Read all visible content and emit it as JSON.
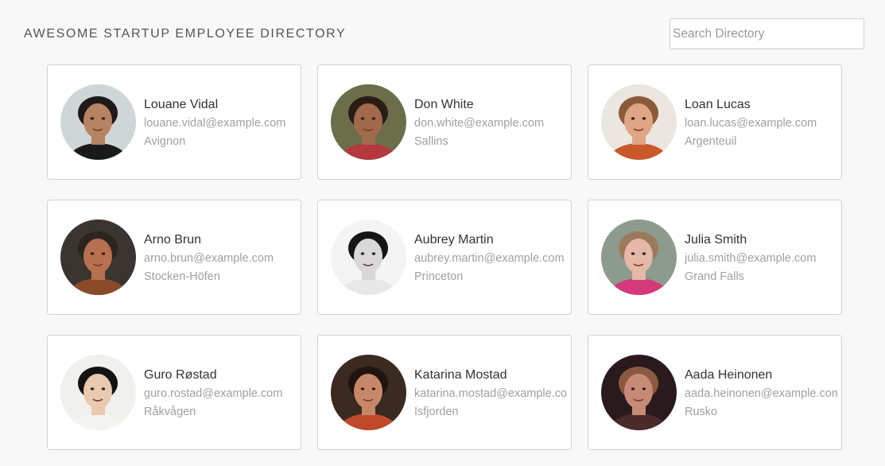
{
  "header": {
    "title": "AWESOME STARTUP EMPLOYEE DIRECTORY",
    "search_placeholder": "Search Directory"
  },
  "employees": [
    {
      "name": "Louane Vidal",
      "email": "louane.vidal@example.com",
      "city": "Avignon"
    },
    {
      "name": "Don White",
      "email": "don.white@example.com",
      "city": "Sallins"
    },
    {
      "name": "Loan Lucas",
      "email": "loan.lucas@example.com",
      "city": "Argenteuil"
    },
    {
      "name": "Arno Brun",
      "email": "arno.brun@example.com",
      "city": "Stocken-Höfen"
    },
    {
      "name": "Aubrey Martin",
      "email": "aubrey.martin@example.com",
      "city": "Princeton"
    },
    {
      "name": "Julia Smith",
      "email": "julia.smith@example.com",
      "city": "Grand Falls"
    },
    {
      "name": "Guro Røstad",
      "email": "guro.rostad@example.com",
      "city": "Råkvågen"
    },
    {
      "name": "Katarina Mostad",
      "email": "katarina.mostad@example.com",
      "city": "Isfjorden"
    },
    {
      "name": "Aada Heinonen",
      "email": "aada.heinonen@example.com",
      "city": "Rusko"
    }
  ],
  "avatar_palettes": [
    {
      "bg": "#cfd6d8",
      "skin": "#b68363",
      "hair": "#1e1a1a",
      "shirt": "#1a1a1a"
    },
    {
      "bg": "#6b6e4a",
      "skin": "#a26a4c",
      "hair": "#2a1d16",
      "shirt": "#b23a3f"
    },
    {
      "bg": "#ece6e0",
      "skin": "#e0a585",
      "hair": "#8a5a3a",
      "shirt": "#c9582a"
    },
    {
      "bg": "#3a3530",
      "skin": "#b77050",
      "hair": "#2b2420",
      "shirt": "#8a4a2a"
    },
    {
      "bg": "#f4f4f4",
      "skin": "#d8d8d8",
      "hair": "#151515",
      "shirt": "#e8e8e8"
    },
    {
      "bg": "#8d9a8e",
      "skin": "#e6b8a8",
      "hair": "#9a7a5a",
      "shirt": "#d43a7a"
    },
    {
      "bg": "#f0f0ec",
      "skin": "#e9c9b0",
      "hair": "#141212",
      "shirt": "#f4f4f0"
    },
    {
      "bg": "#3a2a20",
      "skin": "#c88868",
      "hair": "#1e1410",
      "shirt": "#c04a2a"
    },
    {
      "bg": "#2a1a1e",
      "skin": "#c88a78",
      "hair": "#8a5a40",
      "shirt": "#4a2a2a"
    }
  ]
}
